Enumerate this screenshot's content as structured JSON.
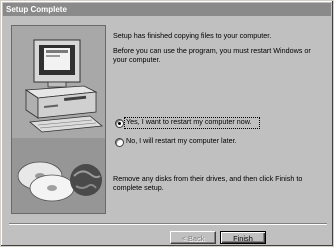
{
  "window": {
    "title": "Setup Complete"
  },
  "content": {
    "paragraph1": "Setup has finished copying files to your computer.",
    "paragraph2_line1": "Before you can use the program, you must restart Windows or",
    "paragraph2_line2": "your computer.",
    "options": [
      {
        "label": "Yes, I want to restart my computer now.",
        "selected": true
      },
      {
        "label": "No, I will restart my computer later.",
        "selected": false
      }
    ],
    "note_line1": "Remove any disks from their drives, and then click Finish to",
    "note_line2": "complete setup."
  },
  "buttons": {
    "back": "< Back",
    "finish": "Finish"
  },
  "colors": {
    "face": "#c0c0c0",
    "titlebar": "#8a8a8a"
  }
}
